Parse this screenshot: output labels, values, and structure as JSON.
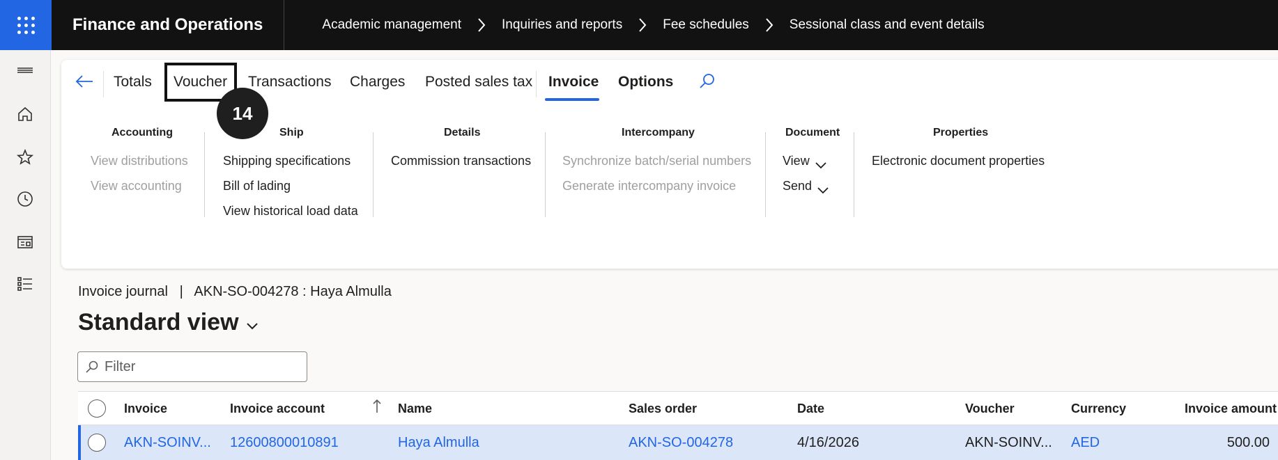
{
  "app": {
    "title": "Finance and Operations"
  },
  "breadcrumbs": [
    "Academic management",
    "Inquiries and reports",
    "Fee schedules",
    "Sessional class and event details"
  ],
  "ribbon": {
    "tabs": {
      "totals": "Totals",
      "voucher": "Voucher",
      "transactions": "Transactions",
      "charges": "Charges",
      "posted_sales_tax": "Posted sales tax",
      "invoice": "Invoice",
      "options": "Options"
    },
    "active_tab": "Invoice",
    "step_badge": "14",
    "groups": {
      "accounting": {
        "title": "Accounting",
        "items": [
          "View distributions",
          "View accounting"
        ]
      },
      "ship": {
        "title": "Ship",
        "items": [
          "Shipping specifications",
          "Bill of lading",
          "View historical load data"
        ]
      },
      "details": {
        "title": "Details",
        "items": [
          "Commission transactions"
        ]
      },
      "intercompany": {
        "title": "Intercompany",
        "items": [
          "Synchronize batch/serial numbers",
          "Generate intercompany invoice"
        ]
      },
      "document": {
        "title": "Document",
        "items": [
          "View",
          "Send"
        ]
      },
      "properties": {
        "title": "Properties",
        "items": [
          "Electronic document properties"
        ]
      }
    }
  },
  "page": {
    "journal_title": "Invoice journal   |   AKN-SO-004278 : Haya Almulla",
    "view_name": "Standard view",
    "filter_placeholder": "Filter"
  },
  "grid": {
    "columns": [
      "Invoice",
      "Invoice account",
      "Name",
      "Sales order",
      "Date",
      "Voucher",
      "Currency",
      "Invoice amount"
    ],
    "rows": [
      [
        "AKN-SOINV...",
        "12600800010891",
        "Haya Almulla",
        "AKN-SO-004278",
        "4/16/2026",
        "AKN-SOINV...",
        "AED",
        "500.00"
      ]
    ]
  },
  "colors": {
    "accent": "#2266e3",
    "topbar": "#121212",
    "selected_row": "#dbe6f9"
  }
}
